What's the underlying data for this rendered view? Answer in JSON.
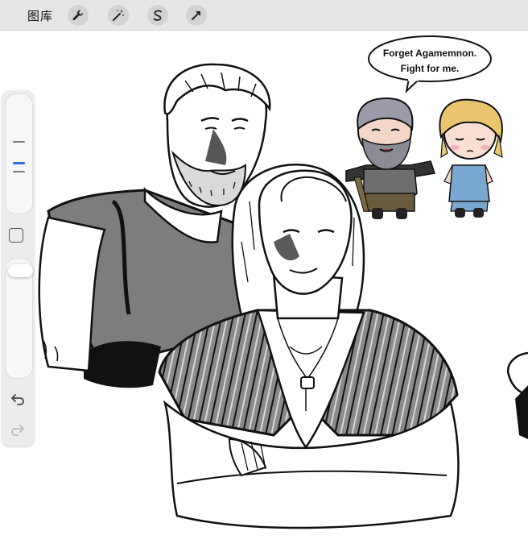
{
  "toolbar": {
    "gallery_label": "图库",
    "tools": [
      "wrench-icon",
      "magic-wand-icon",
      "selection-s-icon",
      "transform-arrow-icon"
    ]
  },
  "sidebar": {
    "brush_size_marks": [
      "size-mark",
      "size-mark-selected",
      "size-mark"
    ],
    "modify_button_icon": "square-icon",
    "undo_icon": "undo-arrow-icon",
    "redo_icon": "redo-arrow-icon"
  },
  "artwork": {
    "speech_bubble": {
      "line1": "Forget Agamemnon.",
      "line2": "Fight for me."
    }
  },
  "colors": {
    "toolbar_bg": "#e6e6e8",
    "accent_blue": "#2f6ee8",
    "ink": "#111111",
    "vest_gray": "#7f7f7f",
    "blonde": "#e9c56d",
    "blue_tunic": "#7aa7cf"
  }
}
